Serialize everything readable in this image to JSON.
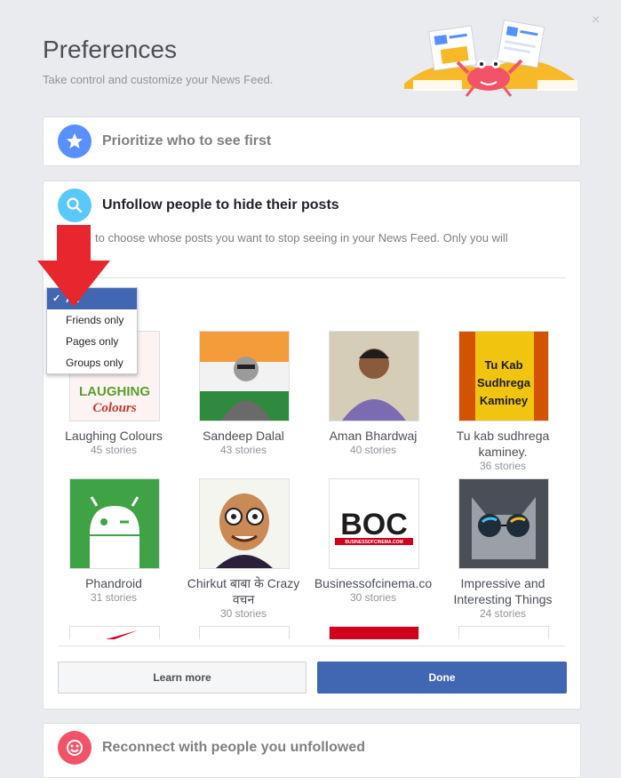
{
  "dialog": {
    "title": "Preferences",
    "subtitle": "Take control and customize your News Feed.",
    "close_label": "×"
  },
  "sections": {
    "prioritize": {
      "label": "Prioritize who to see first",
      "icon": "star-icon",
      "color": "#5890ff"
    },
    "unfollow": {
      "label": "Unfollow people to hide their posts",
      "icon": "search-icon",
      "color": "#5ac8fa",
      "description": "to choose whose posts you want to stop seeing in your News Feed. Only you will"
    },
    "reconnect": {
      "label": "Reconnect with people you unfollowed",
      "icon": "smiley-icon",
      "color": "#f35369"
    }
  },
  "filter": {
    "options": [
      "All",
      "Friends only",
      "Pages only",
      "Groups only"
    ],
    "selected": "All",
    "check": "✓"
  },
  "people": [
    {
      "name": "Laughing Colours",
      "count": "45 stories"
    },
    {
      "name": "Sandeep Dalal",
      "count": "43 stories"
    },
    {
      "name": "Aman Bhardwaj",
      "count": "40 stories"
    },
    {
      "name": "Tu kab sudhrega kaminey.",
      "count": "36 stories"
    },
    {
      "name": "Phandroid",
      "count": "31 stories"
    },
    {
      "name": "Chirkut बाबा के Crazy वचन",
      "count": "30 stories"
    },
    {
      "name": "Businessofcinema.co",
      "count": "30 stories"
    },
    {
      "name": "Impressive and Interesting Things",
      "count": "24 stories"
    }
  ],
  "thumb_text": {
    "laughing": [
      "LAUGHING",
      "Colours"
    ],
    "tukab": [
      "Tu Kab",
      "Sudhrega",
      "Kaminey"
    ],
    "boc": [
      "BOC",
      "BUSINESSOFCINEMA.COM"
    ]
  },
  "buttons": {
    "learn_more": "Learn more",
    "done": "Done"
  },
  "colors": {
    "primary": "#4267b2",
    "background": "#e9ebee",
    "arrow": "#e8262d"
  }
}
